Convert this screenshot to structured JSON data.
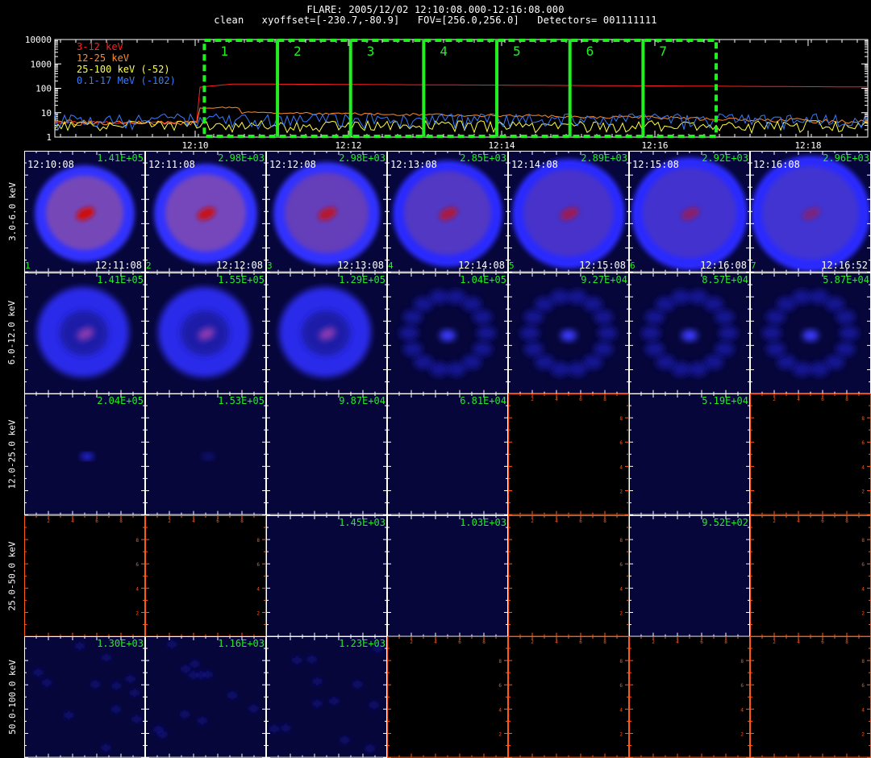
{
  "header": {
    "line1": "FLARE: 2005/12/02 12:10:08.000-12:16:08.000",
    "line2": "clean   xyoffset=[-230.7,-80.9]   FOV=[256.0,256.0]   Detectors= 001111111"
  },
  "lightcurve": {
    "legend": [
      {
        "label": "3-12 keV",
        "color": "#ff2020"
      },
      {
        "label": "12-25 keV",
        "color": "#ff8c28"
      },
      {
        "label": "25-100 keV (-52)",
        "color": "#ffff40"
      },
      {
        "label": "0.1-17 MeV (-102)",
        "color": "#3a7cff"
      }
    ],
    "y_ticks": [
      "10000",
      "1000",
      "100",
      "10",
      "1"
    ],
    "x_ticks": [
      "12:10",
      "12:12",
      "12:14",
      "12:16",
      "12:18"
    ],
    "intervals": [
      "1",
      "2",
      "3",
      "4",
      "5",
      "6",
      "7"
    ],
    "interval_color": "#22ee22"
  },
  "energy_bands": [
    "3.0-6.0 keV",
    "6.0-12.0 keV",
    "12.0-25.0 keV",
    "25.0-50.0 keV",
    "50.0-100.0 keV"
  ],
  "start_times": [
    "12:10:08",
    "12:11:08",
    "12:12:08",
    "12:13:08",
    "12:14:08",
    "12:15:08",
    "12:16:08"
  ],
  "end_times": [
    "12:11:08",
    "12:12:08",
    "12:13:08",
    "12:14:08",
    "12:15:08",
    "12:16:08",
    "12:16:52"
  ],
  "interval_numbers": [
    "1",
    "2",
    "3",
    "4",
    "5",
    "6",
    "7"
  ],
  "counts": [
    [
      "1.41E+05",
      "2.98E+03",
      "2.98E+03",
      "2.85E+03",
      "2.89E+03",
      "2.92E+03",
      "2.96E+03"
    ],
    [
      "1.41E+05",
      "1.55E+05",
      "1.29E+05",
      "1.04E+05",
      "9.27E+04",
      "8.57E+04",
      "5.87E+04"
    ],
    [
      "2.04E+05",
      "1.53E+05",
      "9.87E+04",
      "6.81E+04",
      "",
      "5.19E+04",
      ""
    ],
    [
      "",
      "",
      "1.45E+03",
      "1.03E+03",
      "",
      "9.52E+02",
      ""
    ],
    [
      "1.30E+03",
      "1.16E+03",
      "1.23E+03",
      "",
      "",
      "",
      ""
    ]
  ],
  "cell_types": [
    [
      "ring",
      "ring",
      "ring",
      "ring",
      "ring",
      "ring",
      "ring"
    ],
    [
      "ring2",
      "ring2",
      "ring2",
      "speck",
      "speck",
      "speck",
      "speck"
    ],
    [
      "dot",
      "dot",
      "flat",
      "flat",
      "empty",
      "flat",
      "empty"
    ],
    [
      "empty",
      "empty",
      "flat",
      "flat",
      "empty",
      "flat",
      "empty"
    ],
    [
      "noise",
      "noise",
      "noise",
      "empty",
      "empty",
      "empty",
      "empty"
    ]
  ],
  "colors": {
    "panel_bg": "#06063a",
    "empty_axis": "#ff5a14",
    "grid_tick": "#ffffff"
  }
}
